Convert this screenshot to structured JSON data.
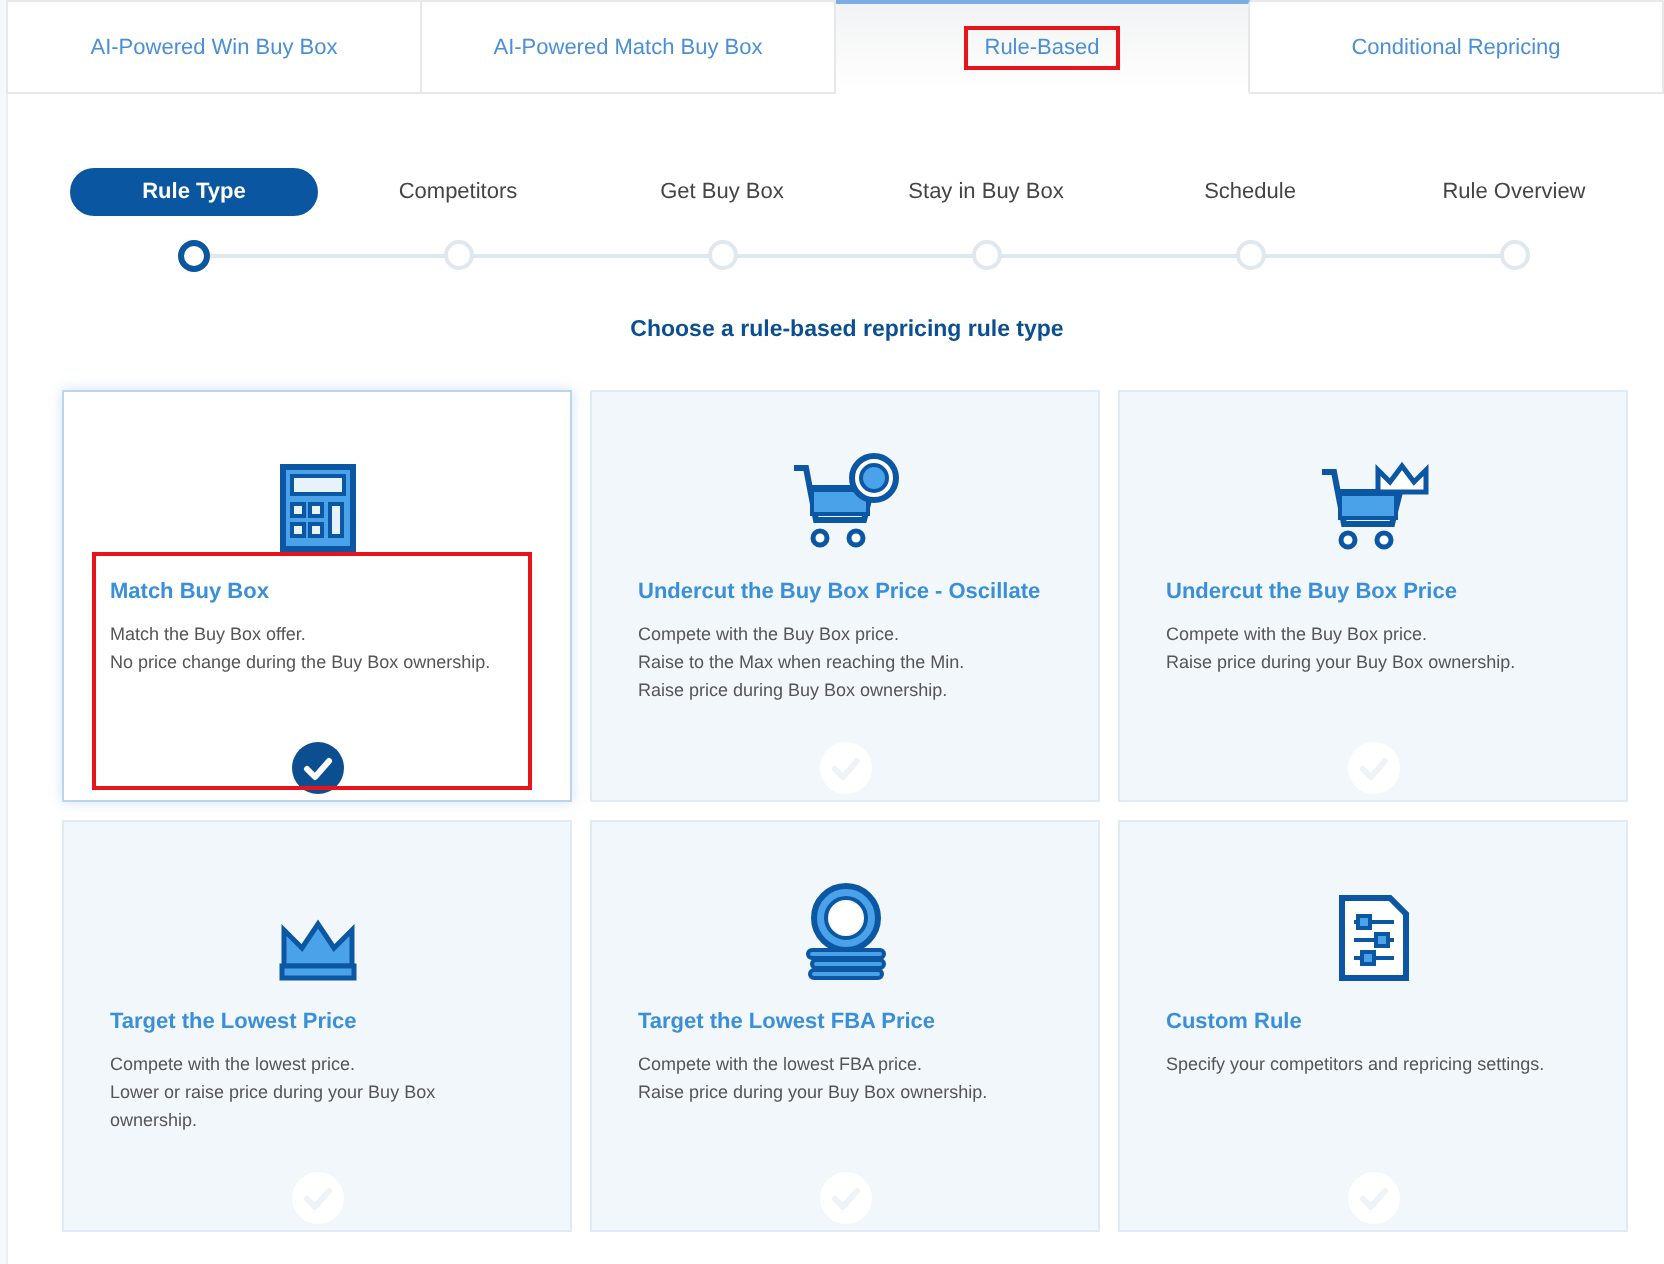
{
  "tabs": [
    {
      "label": "AI-Powered Win Buy Box",
      "selected": false,
      "highlighted": false
    },
    {
      "label": "AI-Powered Match Buy Box",
      "selected": false,
      "highlighted": false
    },
    {
      "label": "Rule-Based",
      "selected": true,
      "highlighted": true
    },
    {
      "label": "Conditional Repricing",
      "selected": false,
      "highlighted": false
    }
  ],
  "steps": [
    {
      "label": "Rule Type",
      "selected": true
    },
    {
      "label": "Competitors",
      "selected": false
    },
    {
      "label": "Get Buy Box",
      "selected": false
    },
    {
      "label": "Stay in Buy Box",
      "selected": false
    },
    {
      "label": "Schedule",
      "selected": false
    },
    {
      "label": "Rule Overview",
      "selected": false
    }
  ],
  "heading": "Choose a rule-based repricing rule type",
  "rule_types": [
    {
      "title": "Match Buy Box",
      "description": [
        "Match the Buy Box offer.",
        "No price change during the Buy Box ownership."
      ],
      "selected": true,
      "highlighted": true
    },
    {
      "title": "Undercut the Buy Box Price - Oscillate",
      "description": [
        "Compete with the Buy Box price.",
        "Raise to the Max when reaching the Min.",
        "Raise price during Buy Box ownership."
      ],
      "selected": false,
      "highlighted": false
    },
    {
      "title": "Undercut the Buy Box Price",
      "description": [
        "Compete with the Buy Box price.",
        "Raise price during your Buy Box ownership."
      ],
      "selected": false,
      "highlighted": false
    },
    {
      "title": "Target the Lowest Price",
      "description": [
        "Compete with the lowest price.",
        "Lower or raise price during your Buy Box ownership."
      ],
      "selected": false,
      "highlighted": false
    },
    {
      "title": "Target the Lowest FBA Price",
      "description": [
        "Compete with the lowest FBA price.",
        "Raise price during your Buy Box ownership."
      ],
      "selected": false,
      "highlighted": false
    },
    {
      "title": "Custom Rule",
      "description": [
        "Specify your competitors and repricing settings."
      ],
      "selected": false,
      "highlighted": false
    }
  ]
}
